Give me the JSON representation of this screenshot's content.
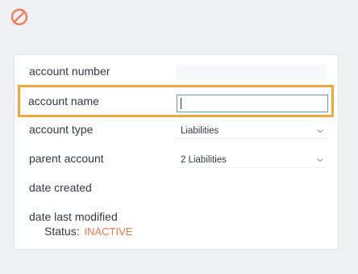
{
  "header": {
    "cancel_icon": "cancel-icon",
    "cancel_color": "#f07a5a"
  },
  "form": {
    "account_number": {
      "label": "account number",
      "value": ""
    },
    "account_name": {
      "label": "account name",
      "value": ""
    },
    "account_type": {
      "label": "account type",
      "selected": "Liabilities"
    },
    "parent_account": {
      "label": "parent account",
      "selected": "2 Liabilities"
    },
    "date_created": {
      "label": "date created",
      "value": ""
    },
    "date_last_modified": {
      "label": "date last modified",
      "value": ""
    },
    "status": {
      "label": "Status:",
      "value": "INACTIVE"
    }
  },
  "colors": {
    "highlight": "#f0a73e",
    "status_inactive": "#e0794a",
    "input_border": "#6b9bb2"
  }
}
